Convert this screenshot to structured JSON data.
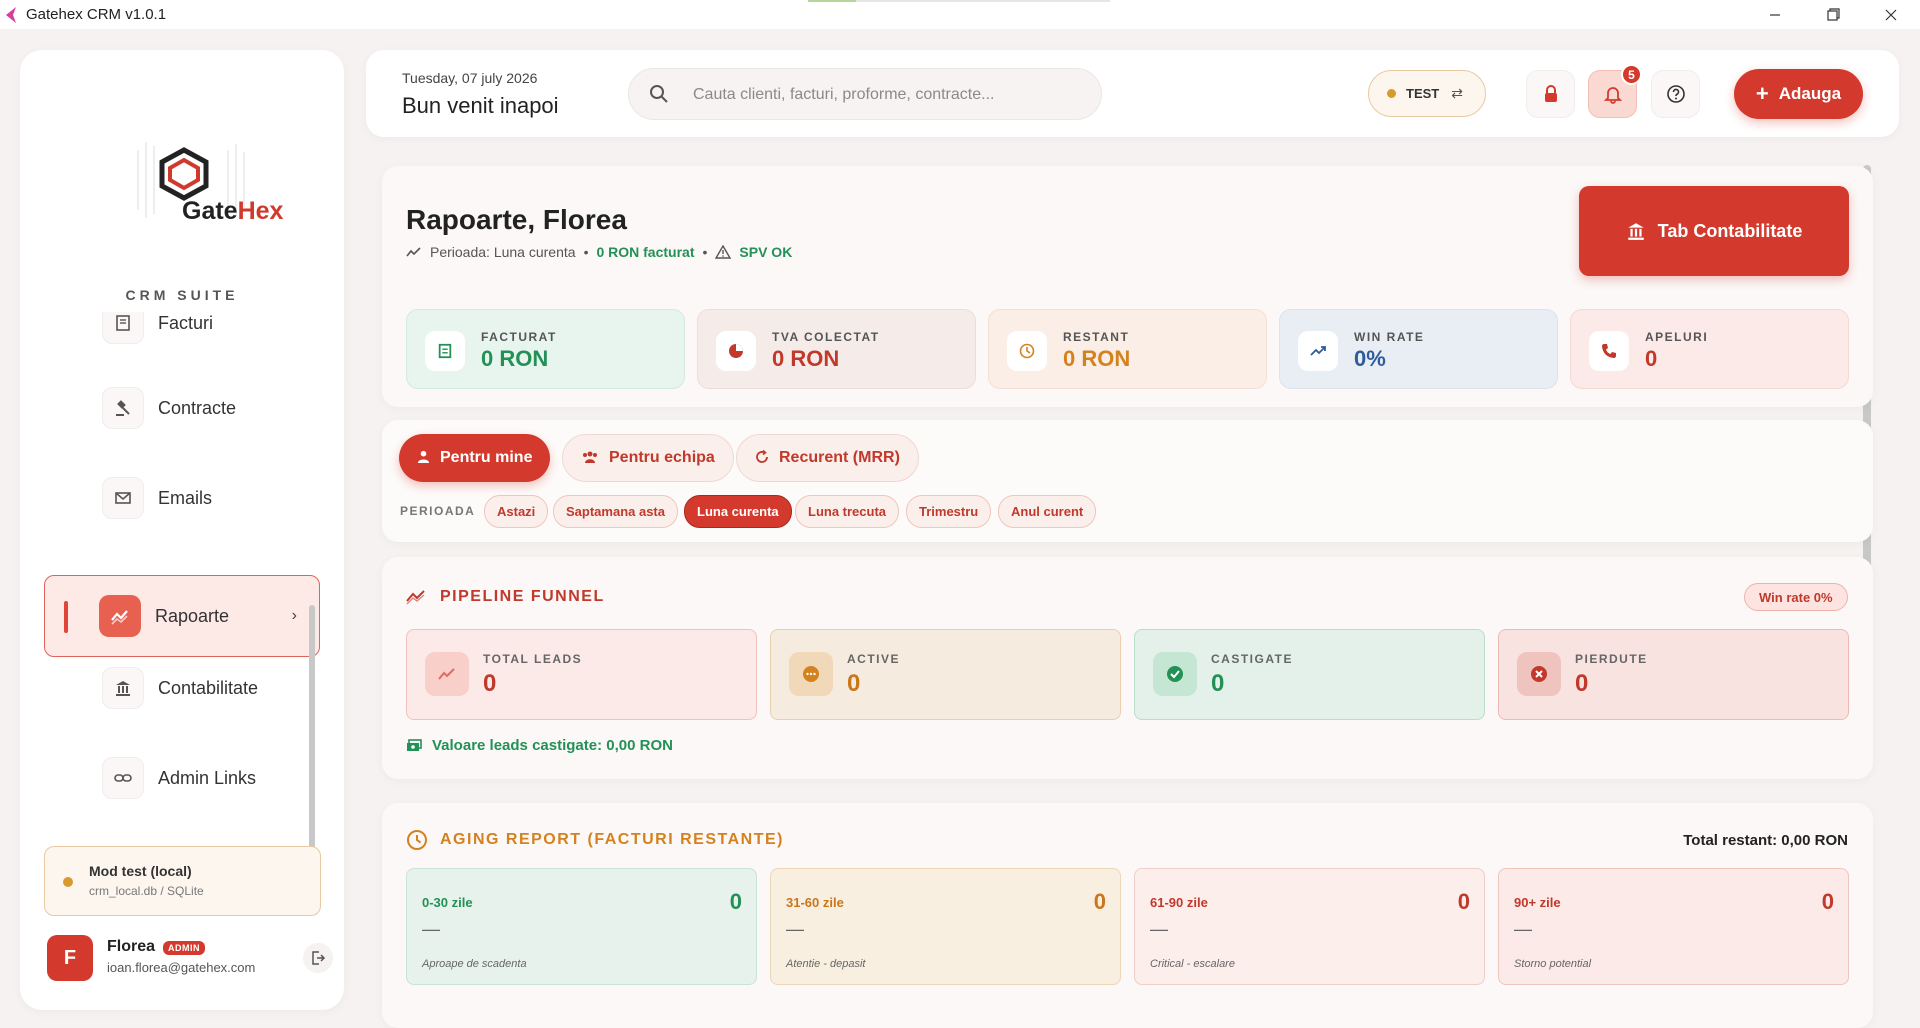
{
  "window": {
    "title": "Gatehex CRM v1.0.1",
    "load_progress": 0.16
  },
  "sidebar": {
    "logo": {
      "part1": "Gate",
      "part2": "Hex"
    },
    "suite": "CRM SUITE",
    "items": [
      {
        "label": "Facturi",
        "icon": "receipt-icon"
      },
      {
        "label": "Contracte",
        "icon": "gavel-icon"
      },
      {
        "label": "Emails",
        "icon": "mail-icon"
      },
      {
        "label": "Rapoarte",
        "icon": "chart-trend-icon",
        "active": true
      },
      {
        "label": "Contabilitate",
        "icon": "bank-icon"
      },
      {
        "label": "Admin Links",
        "icon": "link-icon"
      }
    ],
    "test_mode": {
      "title": "Mod test (local)",
      "db": "crm_local.db / SQLite"
    },
    "user": {
      "initial": "F",
      "name": "Florea",
      "role": "ADMIN",
      "email": "ioan.florea@gatehex.com"
    }
  },
  "header": {
    "date": "Tuesday, 07 july 2026",
    "welcome": "Bun venit inapoi",
    "search_placeholder": "Cauta clienti, facturi, proforme, contracte...",
    "env": "TEST",
    "notifications": "5",
    "add_label": "Adauga"
  },
  "report": {
    "title": "Rapoarte, Florea",
    "period_text": "Perioada: Luna curenta",
    "billed_text": "0 RON facturat",
    "spv_text": "SPV OK",
    "tab_button": "Tab Contabilitate",
    "kpis": [
      {
        "label": "FACTURAT",
        "value": "0 RON",
        "color": "#239156"
      },
      {
        "label": "TVA COLECTAT",
        "value": "0 RON",
        "color": "#c0392b"
      },
      {
        "label": "RESTANT",
        "value": "0 RON",
        "color": "#d4821f"
      },
      {
        "label": "WIN RATE",
        "value": "0%",
        "color": "#2f5c9a"
      },
      {
        "label": "APELURI",
        "value": "0",
        "color": "#c0392b"
      }
    ]
  },
  "filters": {
    "scopes": [
      "Pentru mine",
      "Pentru echipa",
      "Recurent (MRR)"
    ],
    "active_scope": "Pentru mine",
    "period_label": "PERIOADA",
    "periods": [
      "Astazi",
      "Saptamana asta",
      "Luna curenta",
      "Luna trecuta",
      "Trimestru",
      "Anul curent"
    ],
    "active_period": "Luna curenta"
  },
  "pipeline": {
    "title": "PIPELINE FUNNEL",
    "win_rate_badge": "Win rate 0%",
    "boxes": [
      {
        "label": "TOTAL LEADS",
        "value": "0"
      },
      {
        "label": "ACTIVE",
        "value": "0"
      },
      {
        "label": "CASTIGATE",
        "value": "0"
      },
      {
        "label": "PIERDUTE",
        "value": "0"
      }
    ],
    "won_value": "Valoare leads castigate: 0,00 RON"
  },
  "aging": {
    "title": "AGING REPORT (FACTURI RESTANTE)",
    "total": "Total restant: 0,00 RON",
    "buckets": [
      {
        "label": "0-30 zile",
        "value": "0",
        "amount": "—",
        "note": "Aproape de scadenta"
      },
      {
        "label": "31-60 zile",
        "value": "0",
        "amount": "—",
        "note": "Atentie - depasit"
      },
      {
        "label": "61-90 zile",
        "value": "0",
        "amount": "—",
        "note": "Critical - escalare"
      },
      {
        "label": "90+ zile",
        "value": "0",
        "amount": "—",
        "note": "Storno potential"
      }
    ]
  },
  "colors": {
    "accent": "#d33a2d",
    "green": "#239156",
    "amber": "#d4821f",
    "blue": "#2f5c9a"
  }
}
